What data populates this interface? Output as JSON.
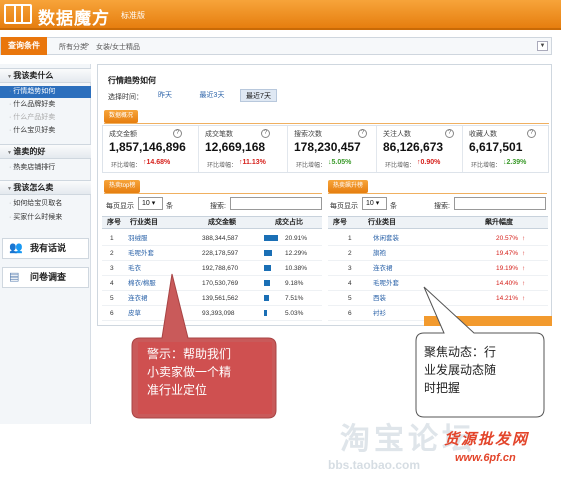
{
  "app": {
    "title": "数据魔方",
    "edition": "标准版"
  },
  "conditions": {
    "label": "查询条件",
    "breadcrumb": [
      "所有分类",
      ">",
      "女装/女士精品"
    ],
    "dropdown_icon": "chevron-down-icon"
  },
  "sidebar": {
    "sections": [
      {
        "title": "我该卖什么",
        "items": [
          {
            "label": "行情趋势如何",
            "active": true
          },
          {
            "label": "什么品牌好卖"
          },
          {
            "label": "什么产品好卖",
            "dim": true
          },
          {
            "label": "什么宝贝好卖"
          }
        ]
      },
      {
        "title": "谁卖的好",
        "items": [
          {
            "label": "热卖店铺排行"
          }
        ]
      },
      {
        "title": "我该怎么卖",
        "items": [
          {
            "label": "如何给宝贝取名"
          },
          {
            "label": "买家什么时候来"
          }
        ]
      }
    ],
    "cards": [
      {
        "label": "我有话说",
        "icon": "people-icon"
      },
      {
        "label": "问卷调查",
        "icon": "document-icon"
      }
    ]
  },
  "trend": {
    "title": "行情趋势如何",
    "time_label": "选择时间：",
    "time_options": [
      "昨天",
      "最近3天",
      "最近7天"
    ],
    "selected_time": "最近7天"
  },
  "overview": {
    "tag": "数据概况",
    "change_label": "环比增幅：",
    "metrics": [
      {
        "name": "成交金额",
        "value": "1,857,146,896",
        "change": "14.68%",
        "dir": "up"
      },
      {
        "name": "成交笔数",
        "value": "12,669,168",
        "change": "11.13%",
        "dir": "up"
      },
      {
        "name": "搜索次数",
        "value": "178,230,457",
        "change": "5.05%",
        "dir": "down"
      },
      {
        "name": "关注人数",
        "value": "86,126,673",
        "change": "0.90%",
        "dir": "up"
      },
      {
        "name": "收藏人数",
        "value": "6,617,501",
        "change": "2.39%",
        "dir": "down"
      }
    ]
  },
  "hot_sales": {
    "tag": "热卖top榜",
    "per_page_label": "每页显示",
    "per_page_value": "10",
    "per_page_unit": "条",
    "search_label": "搜索:",
    "headers": [
      "序号",
      "行业类目",
      "成交金额",
      "成交占比"
    ],
    "rows": [
      {
        "rank": "1",
        "category": "羽绒服",
        "amount": "388,344,587",
        "share": "20.91%",
        "share_pct": 20.91
      },
      {
        "rank": "2",
        "category": "毛呢外套",
        "amount": "228,178,597",
        "share": "12.29%",
        "share_pct": 12.29
      },
      {
        "rank": "3",
        "category": "毛衣",
        "amount": "192,788,670",
        "share": "10.38%",
        "share_pct": 10.38
      },
      {
        "rank": "4",
        "category": "棉衣/棉服",
        "amount": "170,530,769",
        "share": "9.18%",
        "share_pct": 9.18
      },
      {
        "rank": "5",
        "category": "连衣裙",
        "amount": "139,561,562",
        "share": "7.51%",
        "share_pct": 7.51
      },
      {
        "rank": "6",
        "category": "皮草",
        "amount": "93,393,098",
        "share": "5.03%",
        "share_pct": 5.03
      }
    ]
  },
  "hot_rise": {
    "tag": "热卖飙升榜",
    "per_page_label": "每页显示",
    "per_page_value": "10",
    "per_page_unit": "条",
    "search_label": "搜索:",
    "headers": [
      "序号",
      "行业类目",
      "飙升幅度"
    ],
    "rows": [
      {
        "rank": "1",
        "category": "休闲套装",
        "rise": "20.57%"
      },
      {
        "rank": "2",
        "category": "旗袍",
        "rise": "19.47%"
      },
      {
        "rank": "3",
        "category": "连衣裙",
        "rise": "19.19%"
      },
      {
        "rank": "4",
        "category": "毛呢外套",
        "rise": "14.40%"
      },
      {
        "rank": "5",
        "category": "西装",
        "rise": "14.21%"
      },
      {
        "rank": "6",
        "category": "衬衫",
        "rise": ""
      }
    ]
  },
  "callouts": {
    "left": [
      "警示：帮助我们",
      "小卖家做一个精",
      "准行业定位"
    ],
    "right": [
      "聚焦动态：行",
      "业发展动态随",
      "时把握"
    ]
  },
  "watermark": {
    "logo": "淘宝论坛",
    "url": "bbs.taobao.com",
    "brand": "货源批发网",
    "site": "www.6pf.cn"
  },
  "colors": {
    "brand_orange": "#e9760c",
    "active_blue": "#2c6fbd",
    "callout_red": "#d44a4a",
    "up_red": "#d6201b",
    "down_green": "#3a9a2a"
  }
}
